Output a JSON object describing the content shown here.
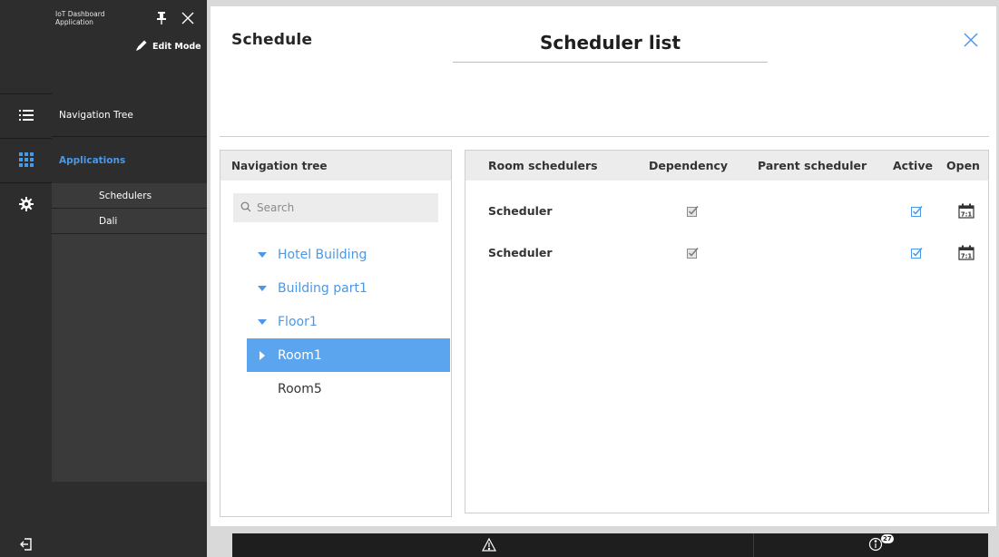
{
  "sidebar": {
    "app_title": "IoT Dashboard Application",
    "edit_mode_label": "Edit Mode",
    "nav_tree_label": "Navigation Tree",
    "applications_label": "Applications",
    "sub_items": [
      {
        "label": "Schedulers"
      },
      {
        "label": "Dali"
      }
    ],
    "accent_color": "#4a98e8"
  },
  "header": {
    "schedule_label": "Schedule",
    "list_title": "Scheduler list"
  },
  "tree": {
    "title": "Navigation tree",
    "search_placeholder": "Search",
    "items": [
      {
        "label": "Hotel Building",
        "state": "expanded"
      },
      {
        "label": "Building part1",
        "state": "expanded"
      },
      {
        "label": "Floor1",
        "state": "expanded"
      },
      {
        "label": "Room1",
        "state": "selected"
      },
      {
        "label": "Room5",
        "state": "leaf"
      }
    ]
  },
  "table": {
    "columns": [
      "Room schedulers",
      "Dependency",
      "Parent scheduler",
      "Active",
      "Open"
    ],
    "rows": [
      {
        "name": "Scheduler",
        "dependency": true,
        "parent": "",
        "active": true,
        "open_icon": "calendar-icon"
      },
      {
        "name": "Scheduler",
        "dependency": true,
        "parent": "",
        "active": true,
        "open_icon": "calendar-icon"
      }
    ]
  },
  "status_bar": {
    "notification_count": "27"
  }
}
